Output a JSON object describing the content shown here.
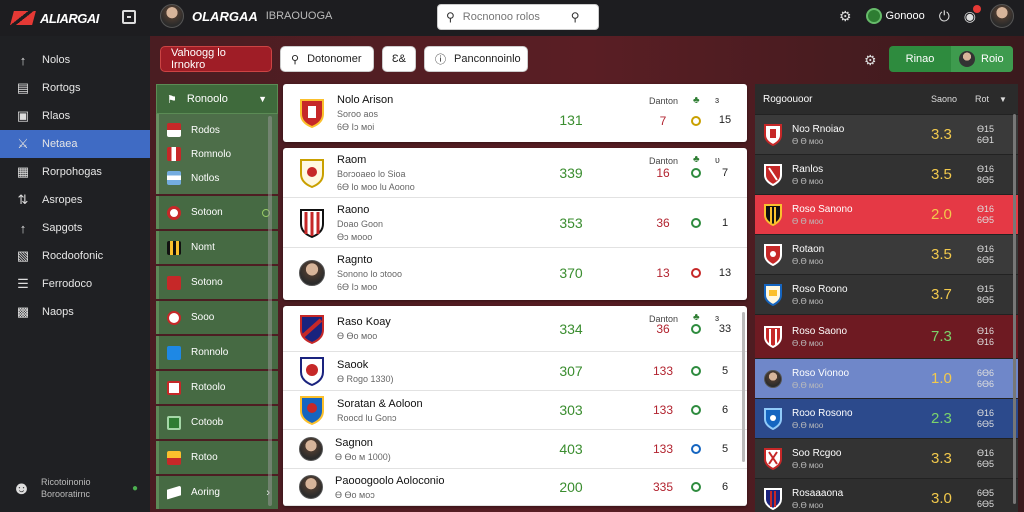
{
  "app": {
    "title": "ALIARGAI"
  },
  "topbar": {
    "brand_name": "OLARGAA",
    "brand_sub": "IBRAOUOGA",
    "search_placeholder": "Rocnonoo rolos",
    "coins": "Gonooo",
    "icons": [
      "settings-gear-icon",
      "coin-icon",
      "power-icon",
      "notification-icon",
      "profile-avatar"
    ]
  },
  "sidebar": {
    "items": [
      {
        "label": "Nolos",
        "icon": "arrow-up-icon"
      },
      {
        "label": "Rortogs",
        "icon": "book-icon"
      },
      {
        "label": "Rlaos",
        "icon": "document-icon"
      },
      {
        "label": "Netaea",
        "icon": "crossed-swords-icon",
        "active": true
      },
      {
        "label": "Rorpohogas",
        "icon": "image-icon"
      },
      {
        "label": "Asropes",
        "icon": "arrows-icon"
      },
      {
        "label": "Sapgots",
        "icon": "upload-icon"
      },
      {
        "label": "Rocdoofonic",
        "icon": "monitor-icon"
      },
      {
        "label": "Ferrodoco",
        "icon": "list-icon"
      },
      {
        "label": "Naops",
        "icon": "calendar-icon"
      }
    ],
    "footer_line1": "Ricotoinonio",
    "footer_line2": "Borooratirnc"
  },
  "toolbar": {
    "primary": "Vahoogg lo Irnokro",
    "search": "Dotonomer",
    "code": "Ɛ&",
    "filter": "Panconnoinlo",
    "green_left": "Rinao",
    "green_right": "Roio"
  },
  "leagues": {
    "header": "Ronoolo",
    "rows": [
      "Rodos",
      "Romnolo",
      "Notlos"
    ],
    "items": [
      "Sotoon",
      "Nomt",
      "Sotono",
      "Sooo",
      "Ronnolo",
      "Rotoolo",
      "Cotoob",
      "Rotoo",
      "Aoring"
    ]
  },
  "matches": {
    "groups": [
      {
        "head": [
          "Danton",
          "Ɒ",
          "ɜ"
        ],
        "rows": [
          {
            "name": "Nolo Arison",
            "sub": "Soroo aos",
            "sub2": "6Ɵ Iɔ ᴍoi",
            "score": "131",
            "odds": "7",
            "last": "15"
          }
        ]
      },
      {
        "head": [
          "Danton",
          "Ɒ",
          "ʋ"
        ],
        "rows": [
          {
            "name": "Raom",
            "sub": "Borɔoaeo lo Sioa",
            "sub2": "6Ɵ lo ᴍoo lu Aoono",
            "score": "339",
            "odds": "16",
            "last": "7"
          },
          {
            "name": "Raono",
            "sub": "Doao Goon",
            "sub2": "Ɵɔ ᴍooo",
            "score": "353",
            "odds": "36",
            "last": "1"
          },
          {
            "name": "Ragnto",
            "sub": "Sonono lo ɔtooo",
            "sub2": "6Ɵ Iɔ ᴍoo",
            "score": "370",
            "odds": "13",
            "last": "13"
          }
        ]
      },
      {
        "head": [
          "Danton",
          "Ɒ",
          "ɜ"
        ],
        "rows": [
          {
            "name": "Raso Koay",
            "sub": "Ɵ Ɵo ᴍoo",
            "sub2": "",
            "score": "334",
            "odds": "36",
            "last": "33"
          },
          {
            "name": "Saook",
            "sub": "Ɵ Rogo 1330)",
            "sub2": "",
            "score": "307",
            "odds": "133",
            "last": "5"
          },
          {
            "name": "Soratan & Aoloon",
            "sub": "Roocd lu Gonɔ",
            "sub2": "",
            "score": "303",
            "odds": "133",
            "last": "6"
          },
          {
            "name": "Sagnon",
            "sub": "Ɵ Ɵo ᴍ 1000)",
            "sub2": "",
            "score": "403",
            "odds": "133",
            "last": "5"
          },
          {
            "name": "Paooogoolo Aoloconio",
            "sub": "Ɵ Ɵo ᴍoɔ",
            "sub2": "",
            "score": "200",
            "odds": "335",
            "last": "6"
          }
        ]
      }
    ]
  },
  "standings": {
    "title": "Rogoouoor",
    "col1": "Saono",
    "col2": "Rot",
    "rows": [
      {
        "name": "Noɔ Rnoiao",
        "sub": "Ɵ Ɵ ᴍoo",
        "score": "3.3",
        "small1": "Ɵ15",
        "small2": "6Ɵ1"
      },
      {
        "name": "Ranlos",
        "sub": "Ɵ Ɵ ᴍoo",
        "score": "3.5",
        "small1": "Ɵ16",
        "small2": "8Ɵ5"
      },
      {
        "name": "Roso Sanono",
        "sub": "Ɵ Ɵ ᴍoo",
        "score": "2.0",
        "small1": "Ɵ16",
        "small2": "6Ɵ5"
      },
      {
        "name": "Rotaon",
        "sub": "Ɵ.Ɵ ᴍoo",
        "score": "3.5",
        "small1": "Ɵ16",
        "small2": "6Ɵ5"
      },
      {
        "name": "Roso Roono",
        "sub": "Ɵ.Ɵ ᴍoo",
        "score": "3.7",
        "small1": "Ɵ15",
        "small2": "8Ɵ5"
      },
      {
        "name": "Roso Saono",
        "sub": "Ɵ.Ɵ ᴍoo",
        "score": "7.3",
        "small1": "Ɵ16",
        "small2": "Ɵ16"
      },
      {
        "name": "Roso Vionoo",
        "sub": "Ɵ.Ɵ ᴍoo",
        "score": "1.0",
        "small1": "6Ɵ6",
        "small2": "6Ɵ6"
      },
      {
        "name": "Roɔo Rosono",
        "sub": "Ɵ.Ɵ ᴍoo",
        "score": "2.3",
        "small1": "Ɵ16",
        "small2": "6Ɵ5"
      },
      {
        "name": "Soo Rcgoo",
        "sub": "Ɵ.Ɵ ᴍoo",
        "score": "3.3",
        "small1": "Ɵ16",
        "small2": "6Ɵ5"
      },
      {
        "name": "Rosaaaona",
        "sub": "Ɵ.Ɵ ᴍoo",
        "score": "3.0",
        "small1": "6Ɵ5",
        "small2": "6Ɵ5"
      }
    ]
  },
  "colors": {
    "accent_red": "#9f1d26",
    "green": "#2e8b3e",
    "active_blue": "#3f6bc4",
    "score_gold": "#f2c94c"
  }
}
